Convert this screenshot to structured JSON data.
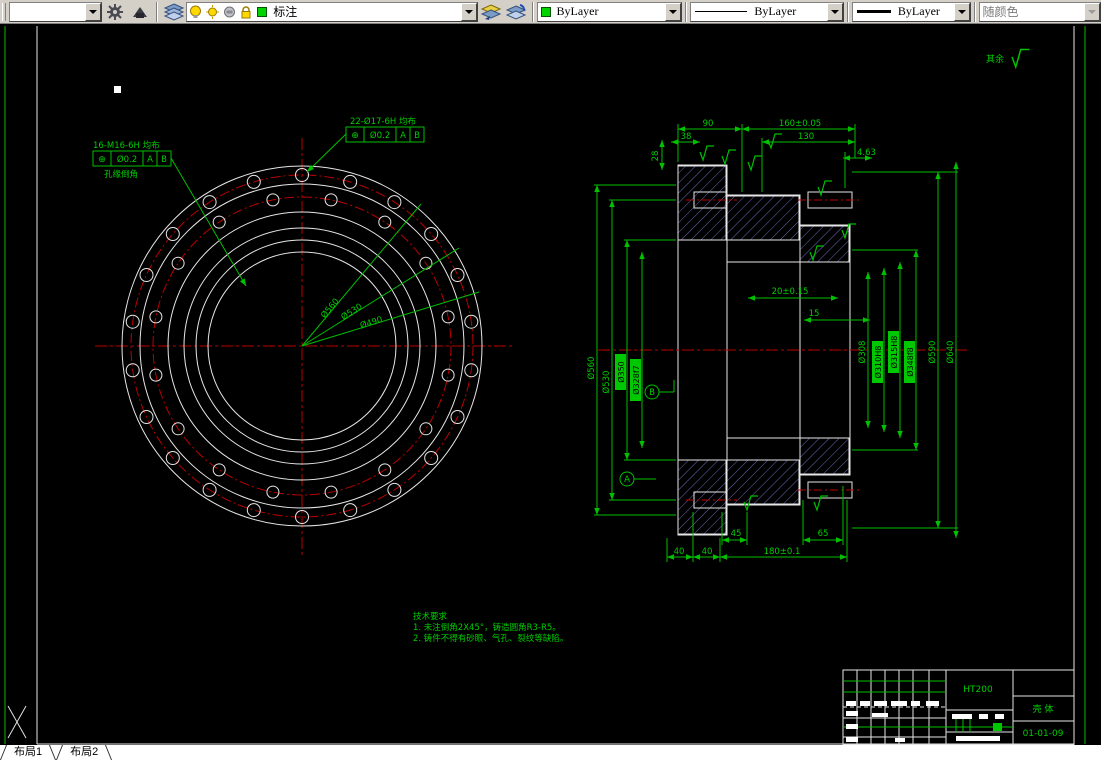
{
  "toolbar": {
    "workspace_combo": "",
    "layer_combo": "标注",
    "color_combo": "ByLayer",
    "linetype_combo": "ByLayer",
    "lineweight_combo": "ByLayer",
    "plotstyle_combo": "随颜色"
  },
  "drawing": {
    "surface_note": "其余",
    "front_view": {
      "thread_label": "16-M16-6H 均布",
      "thread_note": "孔缘倒角",
      "fcf_thread": {
        "symbol": "⊕",
        "tolerance": "Ø0.2",
        "datum1": "A",
        "datum2": "B"
      },
      "hole_label": "22-Ø17-6H 均布",
      "fcf_hole": {
        "symbol": "⊕",
        "tolerance": "Ø0.2",
        "datum1": "A",
        "datum2": "B"
      },
      "radial_dims": [
        "Ø560",
        "Ø530",
        "Ø490"
      ],
      "outer_hole_count": 22,
      "inner_hole_count": 16
    },
    "section_view": {
      "top_dims": {
        "d90": "90",
        "d38": "38",
        "d28": "28",
        "d160": "160±0.05",
        "d130": "130",
        "d463": "4.63"
      },
      "mid_dims": {
        "d20": "20±0.15",
        "d15": "15"
      },
      "bottom_dims": {
        "d40a": "40",
        "d40b": "40",
        "d45": "45",
        "d65": "65",
        "d180": "180±0.1"
      },
      "left_dims": [
        "Ø560",
        "Ø530",
        "Ø350",
        "Ø328f7"
      ],
      "right_dims": [
        "Ø308",
        "Ø310H8",
        "Ø315H8",
        "Ø348f8",
        "Ø590",
        "Ø640"
      ],
      "datum_a": "A",
      "datum_b": "B"
    },
    "tech_req": {
      "title": "技术要求",
      "line1": "1. 未注倒角2X45°，铸造圆角R3-R5。",
      "line2": "2. 铸件不得有砂眼、气孔、裂纹等缺陷。"
    },
    "title_block": {
      "material": "HT200",
      "part_name": "壳  体",
      "drawing_no": "01-01-09"
    }
  },
  "tabs": [
    {
      "label": "布局1"
    },
    {
      "label": "布局2"
    }
  ]
}
